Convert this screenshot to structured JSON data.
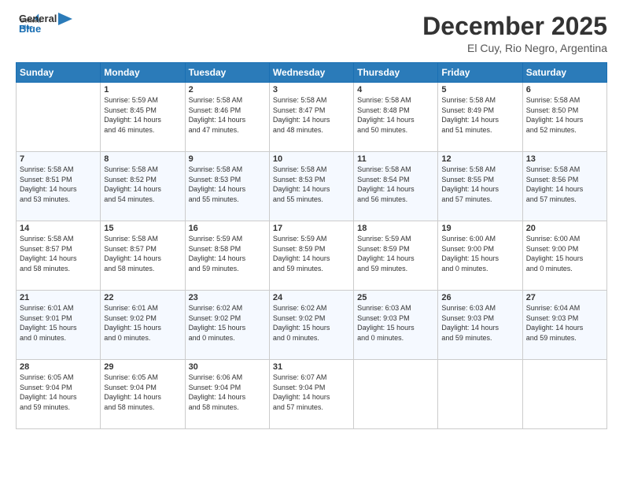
{
  "header": {
    "logo_general": "General",
    "logo_blue": "Blue",
    "month_title": "December 2025",
    "location": "El Cuy, Rio Negro, Argentina"
  },
  "weekdays": [
    "Sunday",
    "Monday",
    "Tuesday",
    "Wednesday",
    "Thursday",
    "Friday",
    "Saturday"
  ],
  "weeks": [
    [
      {
        "day": "",
        "info": ""
      },
      {
        "day": "1",
        "info": "Sunrise: 5:59 AM\nSunset: 8:45 PM\nDaylight: 14 hours\nand 46 minutes."
      },
      {
        "day": "2",
        "info": "Sunrise: 5:58 AM\nSunset: 8:46 PM\nDaylight: 14 hours\nand 47 minutes."
      },
      {
        "day": "3",
        "info": "Sunrise: 5:58 AM\nSunset: 8:47 PM\nDaylight: 14 hours\nand 48 minutes."
      },
      {
        "day": "4",
        "info": "Sunrise: 5:58 AM\nSunset: 8:48 PM\nDaylight: 14 hours\nand 50 minutes."
      },
      {
        "day": "5",
        "info": "Sunrise: 5:58 AM\nSunset: 8:49 PM\nDaylight: 14 hours\nand 51 minutes."
      },
      {
        "day": "6",
        "info": "Sunrise: 5:58 AM\nSunset: 8:50 PM\nDaylight: 14 hours\nand 52 minutes."
      }
    ],
    [
      {
        "day": "7",
        "info": "Sunrise: 5:58 AM\nSunset: 8:51 PM\nDaylight: 14 hours\nand 53 minutes."
      },
      {
        "day": "8",
        "info": "Sunrise: 5:58 AM\nSunset: 8:52 PM\nDaylight: 14 hours\nand 54 minutes."
      },
      {
        "day": "9",
        "info": "Sunrise: 5:58 AM\nSunset: 8:53 PM\nDaylight: 14 hours\nand 55 minutes."
      },
      {
        "day": "10",
        "info": "Sunrise: 5:58 AM\nSunset: 8:53 PM\nDaylight: 14 hours\nand 55 minutes."
      },
      {
        "day": "11",
        "info": "Sunrise: 5:58 AM\nSunset: 8:54 PM\nDaylight: 14 hours\nand 56 minutes."
      },
      {
        "day": "12",
        "info": "Sunrise: 5:58 AM\nSunset: 8:55 PM\nDaylight: 14 hours\nand 57 minutes."
      },
      {
        "day": "13",
        "info": "Sunrise: 5:58 AM\nSunset: 8:56 PM\nDaylight: 14 hours\nand 57 minutes."
      }
    ],
    [
      {
        "day": "14",
        "info": "Sunrise: 5:58 AM\nSunset: 8:57 PM\nDaylight: 14 hours\nand 58 minutes."
      },
      {
        "day": "15",
        "info": "Sunrise: 5:58 AM\nSunset: 8:57 PM\nDaylight: 14 hours\nand 58 minutes."
      },
      {
        "day": "16",
        "info": "Sunrise: 5:59 AM\nSunset: 8:58 PM\nDaylight: 14 hours\nand 59 minutes."
      },
      {
        "day": "17",
        "info": "Sunrise: 5:59 AM\nSunset: 8:59 PM\nDaylight: 14 hours\nand 59 minutes."
      },
      {
        "day": "18",
        "info": "Sunrise: 5:59 AM\nSunset: 8:59 PM\nDaylight: 14 hours\nand 59 minutes."
      },
      {
        "day": "19",
        "info": "Sunrise: 6:00 AM\nSunset: 9:00 PM\nDaylight: 15 hours\nand 0 minutes."
      },
      {
        "day": "20",
        "info": "Sunrise: 6:00 AM\nSunset: 9:00 PM\nDaylight: 15 hours\nand 0 minutes."
      }
    ],
    [
      {
        "day": "21",
        "info": "Sunrise: 6:01 AM\nSunset: 9:01 PM\nDaylight: 15 hours\nand 0 minutes."
      },
      {
        "day": "22",
        "info": "Sunrise: 6:01 AM\nSunset: 9:02 PM\nDaylight: 15 hours\nand 0 minutes."
      },
      {
        "day": "23",
        "info": "Sunrise: 6:02 AM\nSunset: 9:02 PM\nDaylight: 15 hours\nand 0 minutes."
      },
      {
        "day": "24",
        "info": "Sunrise: 6:02 AM\nSunset: 9:02 PM\nDaylight: 15 hours\nand 0 minutes."
      },
      {
        "day": "25",
        "info": "Sunrise: 6:03 AM\nSunset: 9:03 PM\nDaylight: 15 hours\nand 0 minutes."
      },
      {
        "day": "26",
        "info": "Sunrise: 6:03 AM\nSunset: 9:03 PM\nDaylight: 14 hours\nand 59 minutes."
      },
      {
        "day": "27",
        "info": "Sunrise: 6:04 AM\nSunset: 9:03 PM\nDaylight: 14 hours\nand 59 minutes."
      }
    ],
    [
      {
        "day": "28",
        "info": "Sunrise: 6:05 AM\nSunset: 9:04 PM\nDaylight: 14 hours\nand 59 minutes."
      },
      {
        "day": "29",
        "info": "Sunrise: 6:05 AM\nSunset: 9:04 PM\nDaylight: 14 hours\nand 58 minutes."
      },
      {
        "day": "30",
        "info": "Sunrise: 6:06 AM\nSunset: 9:04 PM\nDaylight: 14 hours\nand 58 minutes."
      },
      {
        "day": "31",
        "info": "Sunrise: 6:07 AM\nSunset: 9:04 PM\nDaylight: 14 hours\nand 57 minutes."
      },
      {
        "day": "",
        "info": ""
      },
      {
        "day": "",
        "info": ""
      },
      {
        "day": "",
        "info": ""
      }
    ]
  ]
}
